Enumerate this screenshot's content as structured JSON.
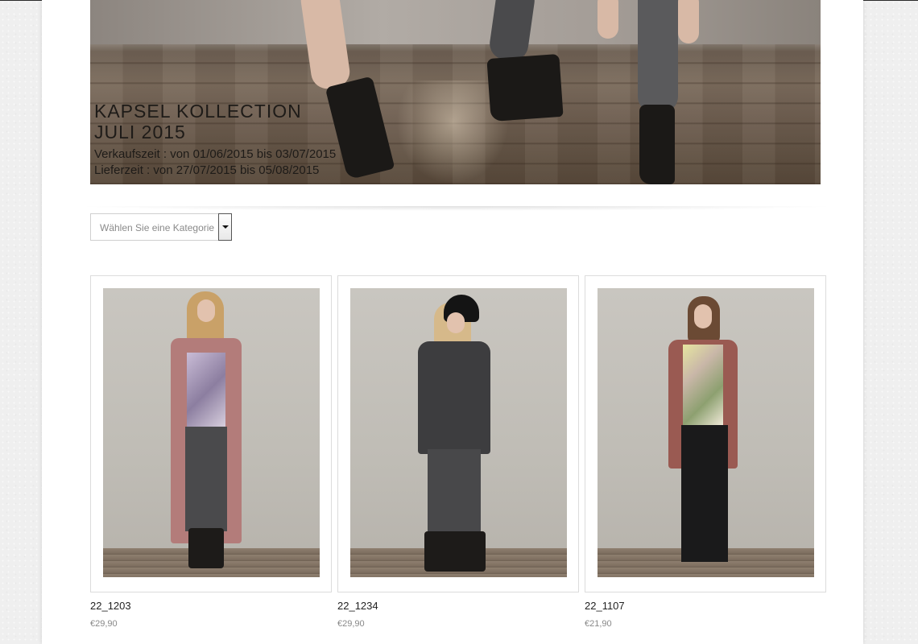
{
  "banner": {
    "title": "KAPSEL KOLLECTION\nJULI 2015",
    "sales_period": "Verkaufszeit : von 01/06/2015 bis 03/07/2015",
    "delivery_period": "Lieferzeit : von 27/07/2015 bis 05/08/2015"
  },
  "category_select": {
    "value": "Wählen Sie eine Kategorie"
  },
  "products": [
    {
      "name": "22_1203",
      "price": "€29,90"
    },
    {
      "name": "22_1234",
      "price": "€29,90"
    },
    {
      "name": "22_1107",
      "price": "€21,90"
    }
  ],
  "colors": {
    "background": "#efefef",
    "page": "#ffffff",
    "text_dark": "#222222",
    "text_muted": "#888888"
  }
}
